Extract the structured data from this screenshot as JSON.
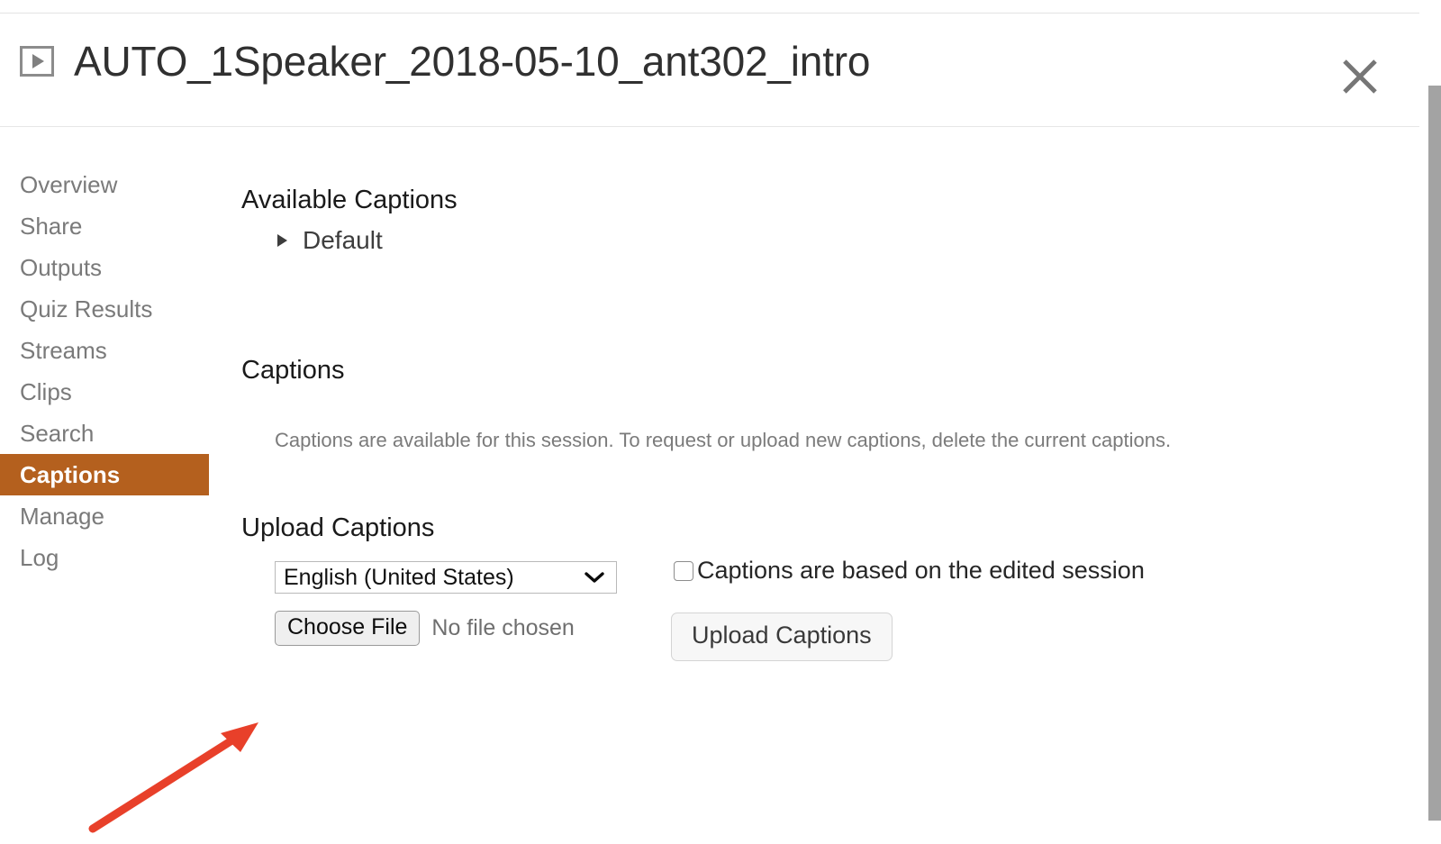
{
  "header": {
    "title": "AUTO_1Speaker_2018-05-10_ant302_intro",
    "play_icon": "play-icon",
    "close_icon": "close-icon"
  },
  "sidebar": {
    "items": [
      {
        "label": "Overview",
        "active": false
      },
      {
        "label": "Share",
        "active": false
      },
      {
        "label": "Outputs",
        "active": false
      },
      {
        "label": "Quiz Results",
        "active": false
      },
      {
        "label": "Streams",
        "active": false
      },
      {
        "label": "Clips",
        "active": false
      },
      {
        "label": "Search",
        "active": false
      },
      {
        "label": "Captions",
        "active": true
      },
      {
        "label": "Manage",
        "active": false
      },
      {
        "label": "Log",
        "active": false
      }
    ],
    "active_color": "#b4601e"
  },
  "main": {
    "available_captions": {
      "heading": "Available Captions",
      "items": [
        {
          "label": "Default",
          "expanded": false
        }
      ]
    },
    "captions": {
      "heading": "Captions",
      "description": "Captions are available for this session. To request or upload new captions, delete the current captions."
    },
    "upload_captions": {
      "heading": "Upload Captions",
      "language_value": "English (United States)",
      "choose_file_label": "Choose File",
      "file_status": "No file chosen",
      "edited_session_label": "Captions are based on the edited session",
      "edited_session_checked": false,
      "upload_button_label": "Upload Captions"
    }
  },
  "annotation": {
    "arrow_color": "#e8402a",
    "points_to": "choose-file-button"
  }
}
